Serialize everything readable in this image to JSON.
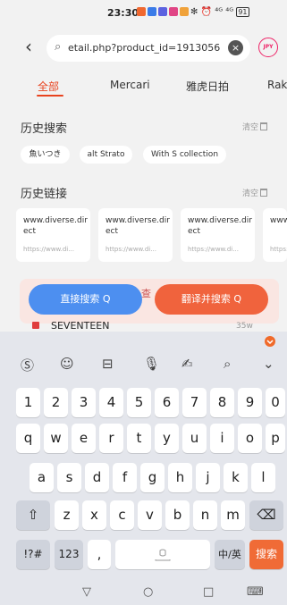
{
  "status": {
    "time": "23:30",
    "right": "✻ ⏰ ⁴ᴳ ⁴ᴳ",
    "battery": "91",
    "app_colors": [
      "#f06830",
      "#3a7be8",
      "#5c62e0",
      "#e04585",
      "#f0a23a"
    ]
  },
  "urlbar": {
    "back_icon": "back-arrow-icon",
    "url": "etail.php?product_id=1913056",
    "badge": "JPY"
  },
  "tabs": [
    {
      "label": "全部",
      "active": true
    },
    {
      "label": "Mercari",
      "active": false
    },
    {
      "label": "雅虎日拍",
      "active": false
    },
    {
      "label": "Rak",
      "active": false
    }
  ],
  "history_search": {
    "title": "历史搜索",
    "clear_label": "清空",
    "chips": [
      "魚いつき",
      "alt Strato",
      "With S collection"
    ]
  },
  "history_links": {
    "title": "历史链接",
    "clear_label": "清空",
    "cards": [
      {
        "title": "www.diverse.direct",
        "url": "https://www.di..."
      },
      {
        "title": "www.diverse.direct",
        "url": "https://www.di..."
      },
      {
        "title": "www.diverse.direct",
        "url": "https://www.di..."
      },
      {
        "title": "www.di irect",
        "url": "https://..."
      }
    ]
  },
  "search_actions": {
    "direct_label": "直接搜索 Q",
    "translate_label": "翻译并搜索 Q",
    "middle_glyph": "查",
    "suggestion": "SEVENTEEN",
    "suggestion_count": "35w"
  },
  "keyboard": {
    "row_numbers": [
      "1",
      "2",
      "3",
      "4",
      "5",
      "6",
      "7",
      "8",
      "9",
      "0"
    ],
    "row_q": [
      {
        "k": "q",
        "s": ""
      },
      {
        "k": "w",
        "s": ""
      },
      {
        "k": "e",
        "s": ""
      },
      {
        "k": "r",
        "s": ""
      },
      {
        "k": "t",
        "s": ""
      },
      {
        "k": "y",
        "s": ""
      },
      {
        "k": "u",
        "s": ""
      },
      {
        "k": "i",
        "s": ""
      },
      {
        "k": "o",
        "s": ""
      },
      {
        "k": "p",
        "s": ""
      }
    ],
    "row_a": [
      {
        "k": "a",
        "s": ""
      },
      {
        "k": "s",
        "s": ""
      },
      {
        "k": "d",
        "s": ""
      },
      {
        "k": "f",
        "s": ""
      },
      {
        "k": "g",
        "s": ""
      },
      {
        "k": "h",
        "s": ""
      },
      {
        "k": "j",
        "s": ""
      },
      {
        "k": "k",
        "s": ""
      },
      {
        "k": "l",
        "s": ""
      }
    ],
    "row_z": [
      "z",
      "x",
      "c",
      "v",
      "b",
      "n",
      "m"
    ],
    "sym_label": "!?#",
    "num_label": "123",
    "comma_label": ",",
    "lang_label": "中/英",
    "search_label": "搜索",
    "shift_icon": "⇧",
    "delete_icon": "⌫"
  },
  "nav": {
    "back": "▽",
    "home": "○",
    "recents": "□",
    "keyboard": "⌨"
  }
}
